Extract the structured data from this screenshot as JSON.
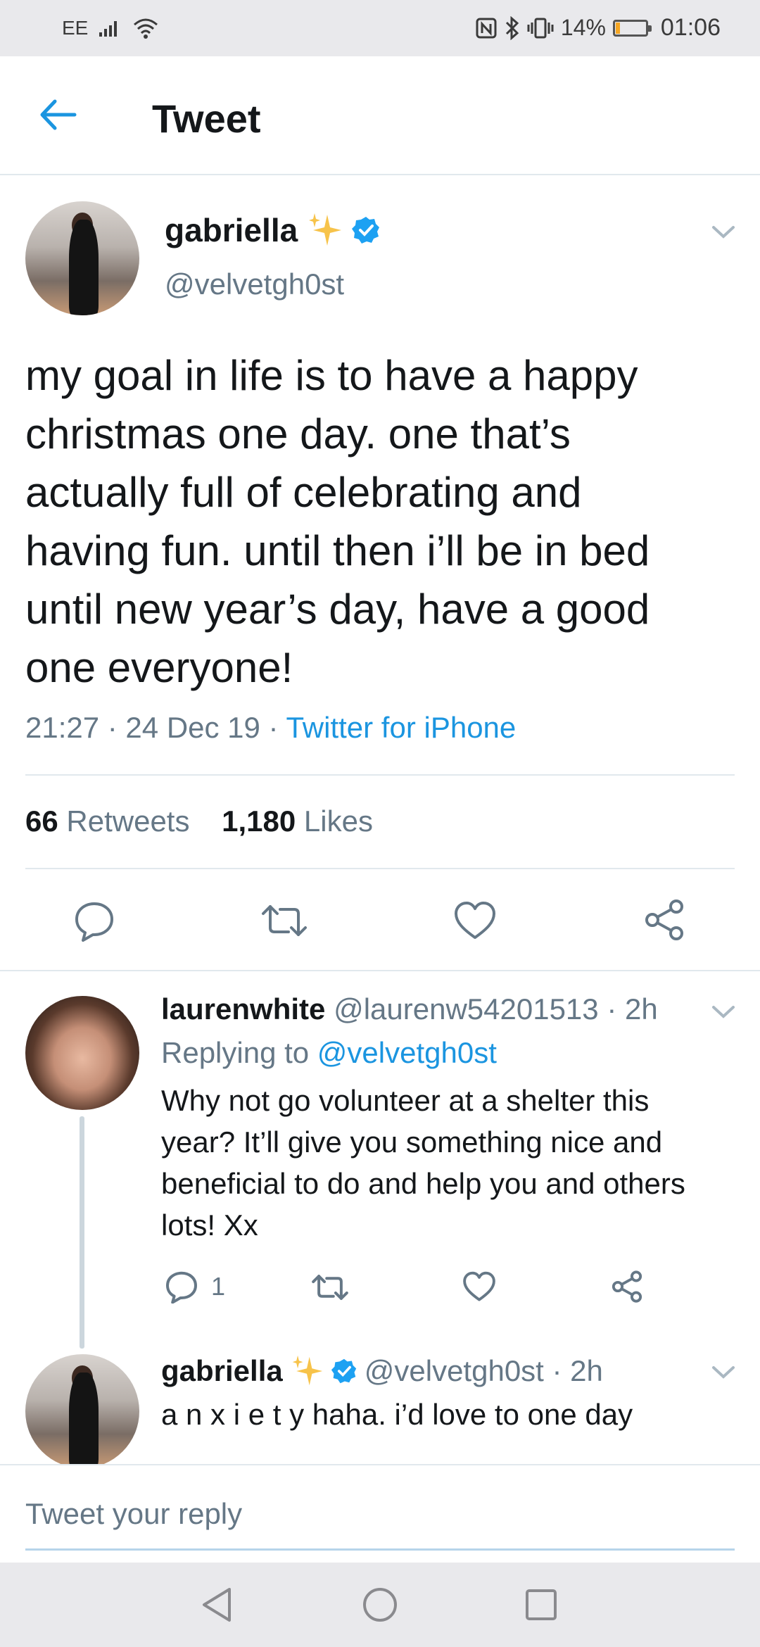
{
  "status_bar": {
    "carrier": "EE",
    "battery": "14%",
    "battery_level": 0.14,
    "time": "01:06"
  },
  "header": {
    "title": "Tweet"
  },
  "main_tweet": {
    "name": "gabriella",
    "handle": "@velvetgh0st",
    "verified": true,
    "text_lines": [
      "my goal in life is to have a happy",
      "christmas one day. one that’s",
      "actually full of celebrating and",
      "having fun. until then i’ll be in bed",
      "until new year’s day, have a good",
      "one everyone!"
    ],
    "timestamp": "21:27 · 24 Dec 19 · ",
    "source": "Twitter for iPhone",
    "retweets_count": "66",
    "retweets_label": "Retweets",
    "likes_count": "1,180",
    "likes_label": "Likes"
  },
  "replies": [
    {
      "name": "laurenwhite",
      "handle_time": "@laurenw54201513 · 2h",
      "replying_prefix": "Replying to ",
      "replying_to": "@velvetgh0st",
      "text_lines": [
        "Why not go volunteer at a shelter this",
        "year? It’ll give you something nice and",
        "beneficial to do and help you and others",
        "lots! Xx"
      ],
      "reply_count": "1"
    },
    {
      "name": "gabriella",
      "handle_time": "@velvetgh0st · 2h",
      "text": "a n x i e t y haha. i’d love to one day"
    }
  ],
  "compose": {
    "placeholder": "Tweet your reply"
  },
  "colors": {
    "accent": "#1b95e0",
    "muted": "#657786",
    "divider": "#e1e8ed",
    "battery": "#f5a623"
  },
  "icons": [
    "back-arrow-icon",
    "sparkles-icon",
    "verified-badge-icon",
    "chevron-down-icon",
    "reply-icon",
    "retweet-icon",
    "like-icon",
    "share-icon",
    "back-nav-icon",
    "home-nav-icon",
    "recents-nav-icon",
    "signal-icon",
    "wifi-icon",
    "nfc-icon",
    "bluetooth-icon",
    "vibrate-icon"
  ]
}
